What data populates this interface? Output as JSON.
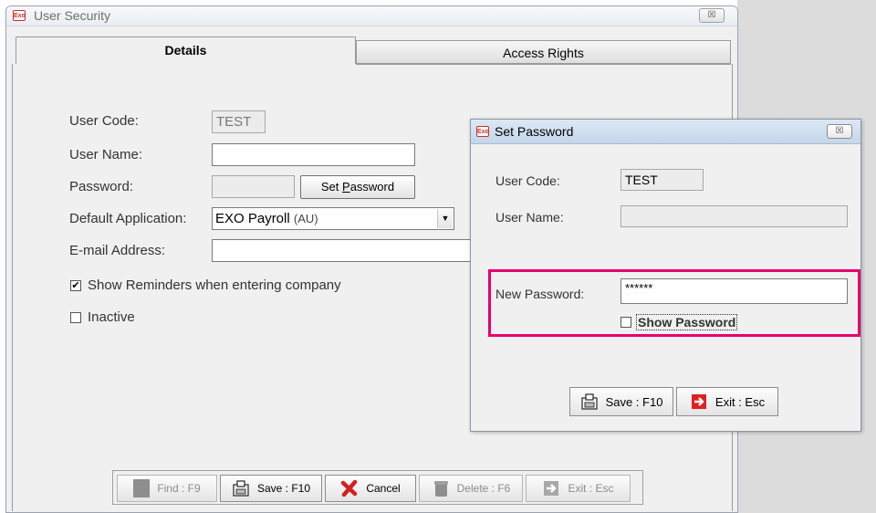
{
  "main_window": {
    "title": "User Security",
    "close_label": "☒",
    "tabs": [
      {
        "label": "Details",
        "active": true
      },
      {
        "label": "Access Rights",
        "active": false
      }
    ],
    "details": {
      "user_code_label": "User Code:",
      "user_code_value": "TEST",
      "user_name_label": "User Name:",
      "user_name_value": "",
      "password_label": "Password:",
      "password_value": "",
      "set_password_pre": "Set ",
      "set_password_key": "P",
      "set_password_post": "assword",
      "default_app_label": "Default Application:",
      "default_app_value": "EXO Payroll",
      "default_app_suffix": "(AU)",
      "email_label": "E-mail Address:",
      "email_value": "",
      "show_reminders_label": "Show Reminders when entering company",
      "show_reminders_checked": true,
      "inactive_label": "Inactive",
      "inactive_checked": false
    },
    "toolbar": [
      {
        "label": "Find : F9",
        "icon": "find-icon",
        "enabled": false
      },
      {
        "label": "Save : F10",
        "icon": "save-icon",
        "enabled": true
      },
      {
        "label": "Cancel",
        "icon": "cancel-icon",
        "enabled": true
      },
      {
        "label": "Delete : F6",
        "icon": "delete-icon",
        "enabled": false
      },
      {
        "label": "Exit : Esc",
        "icon": "exit-icon",
        "enabled": false
      }
    ]
  },
  "set_password_dialog": {
    "title": "Set Password",
    "user_code_label": "User Code:",
    "user_code_value": "TEST",
    "user_name_label": "User Name:",
    "user_name_value": "",
    "new_password_label": "New Password:",
    "new_password_value": "******",
    "show_password_label": "Show Password",
    "show_password_checked": false,
    "save_label": "Save : F10",
    "exit_label": "Exit : Esc"
  },
  "app_logo_text": "Exo",
  "colors": {
    "highlight": "#e5006e",
    "cancel_red": "#d32020",
    "exit_red": "#e02020"
  }
}
